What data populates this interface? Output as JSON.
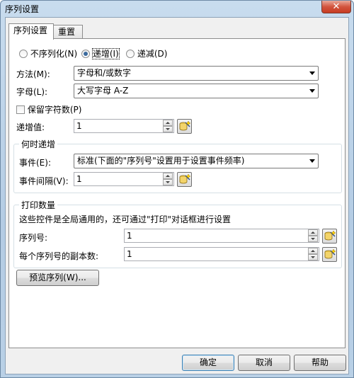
{
  "window": {
    "title": "序列设置",
    "close_symbol": "✕"
  },
  "tabs": [
    {
      "label": "序列设置"
    },
    {
      "label": "重置"
    }
  ],
  "order": {
    "options": [
      {
        "label": "不序列化(N)"
      },
      {
        "label": "递增(I)"
      },
      {
        "label": "递减(D)"
      }
    ],
    "selected": "递增(I)"
  },
  "method": {
    "label": "方法(M):",
    "value": "字母和/或数字"
  },
  "letters": {
    "label": "字母(L):",
    "value": "大写字母 A-Z"
  },
  "keep_chars": {
    "label": "保留字符数(P)",
    "checked": false
  },
  "increment": {
    "label": "递增值:",
    "value": "1"
  },
  "when_increment": {
    "title": "何时递增",
    "event_label": "事件(E):",
    "event_value": "标准(下面的\"序列号\"设置用于设置事件频率)",
    "interval_label": "事件间隔(V):",
    "interval_value": "1"
  },
  "print_qty": {
    "title": "打印数量",
    "note": "这些控件是全局通用的，还可通过\"打印\"对话框进行设置",
    "serial_label": "序列号:",
    "serial_value": "1",
    "copies_label": "每个序列号的副本数:",
    "copies_value": "1"
  },
  "preview_button": "预览序列(W)...",
  "footer": {
    "ok": "确定",
    "cancel": "取消",
    "help": "帮助"
  },
  "icons": {
    "data_source": "database-wand-icon",
    "close": "close-icon"
  }
}
